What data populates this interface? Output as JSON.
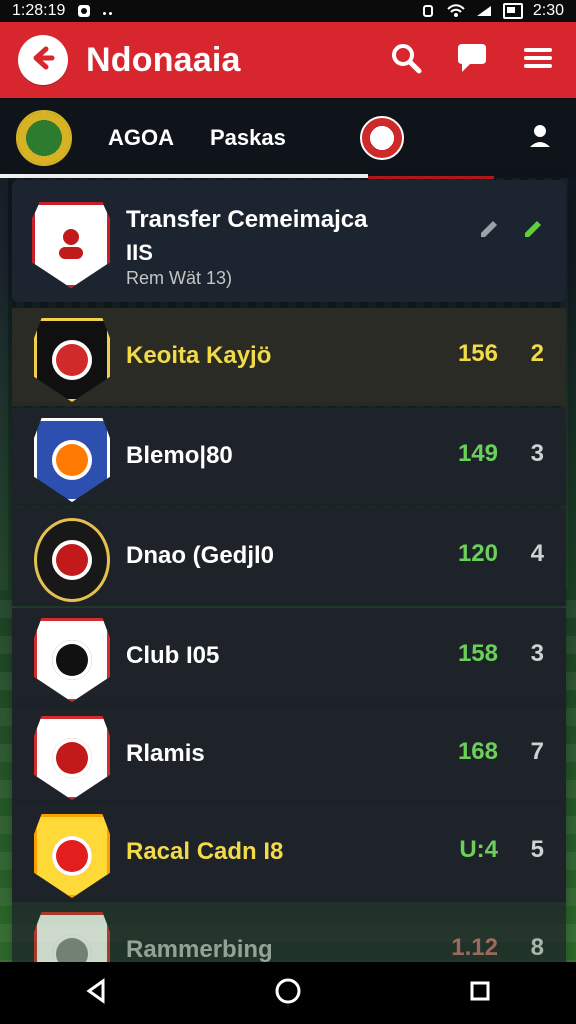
{
  "status_bar": {
    "left_time": "1:28:19",
    "right_time": "2:30"
  },
  "app_bar": {
    "title": "Ndonaaia"
  },
  "tabs": [
    {
      "label": "AGOA"
    },
    {
      "label": "Paskas"
    }
  ],
  "header": {
    "title": "Transfer Cemeimajca",
    "subtitle": "IIS",
    "meta": "Rem Wät 13)"
  },
  "rows": [
    {
      "name": "Keoita Kayjö",
      "points": "156",
      "rank": "2",
      "style": "highlight"
    },
    {
      "name": "Blemo|80",
      "points": "149",
      "rank": "3",
      "style": "normal"
    },
    {
      "name": "Dnao (Gedjl0",
      "points": "120",
      "rank": "4",
      "style": "normal"
    },
    {
      "name": "Club I05",
      "points": "158",
      "rank": "3",
      "style": "normal"
    },
    {
      "name": "Rlamis",
      "points": "168",
      "rank": "7",
      "style": "normal"
    },
    {
      "name": "Racal Cadn I8",
      "points": "U:4",
      "rank": "5",
      "style": "yellow-name"
    },
    {
      "name": "Rammerbing",
      "points": "1.12",
      "rank": "8",
      "style": "pale"
    }
  ],
  "colors": {
    "accent_red": "#d8262e",
    "header_bg": "#1c2430",
    "row_bg": "#1e232a",
    "highlight_bg": "#2a2b24",
    "green": "#6bd05a",
    "yellow": "#f2da49"
  },
  "icons": {
    "back": "arrow-left-icon",
    "search": "search-icon",
    "chat": "chat-icon",
    "menu": "menu-icon",
    "profile": "user-icon",
    "edit": "pencil-icon",
    "nav_back": "triangle-back-icon",
    "nav_home": "circle-home-icon",
    "nav_recent": "square-recent-icon"
  }
}
